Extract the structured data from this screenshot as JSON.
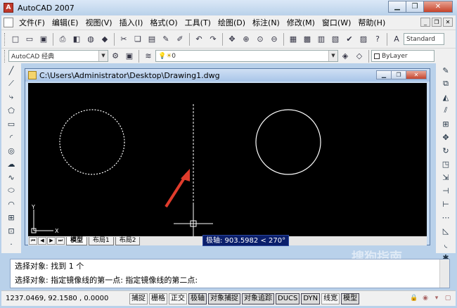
{
  "window": {
    "title": "AutoCAD 2007"
  },
  "menu": [
    "文件(F)",
    "编辑(E)",
    "视图(V)",
    "插入(I)",
    "格式(O)",
    "工具(T)",
    "绘图(D)",
    "标注(N)",
    "修改(M)",
    "窗口(W)",
    "帮助(H)"
  ],
  "toolbar": {
    "text_style": "Standard",
    "workspace": "AutoCAD 经典",
    "layer": "0",
    "color": "ByLayer"
  },
  "drawing_window": {
    "title": "C:\\Users\\Administrator\\Desktop\\Drawing1.dwg"
  },
  "tabs": [
    "模型",
    "布局1",
    "布局2"
  ],
  "ucs": {
    "x_label": "X",
    "y_label": "Y"
  },
  "tooltip": "极轴: 903.5982 < 270°",
  "command": {
    "line1": "选择对象: 找到 1 个",
    "line2": "选择对象:  指定镜像线的第一点: 指定镜像线的第二点:"
  },
  "status": {
    "coords": "1237.0469, 92.1580  , 0.0000",
    "buttons": [
      "捕捉",
      "栅格",
      "正交",
      "极轴",
      "对象捕捉",
      "对象追踪",
      "DUCS",
      "DYN",
      "线宽",
      "模型"
    ]
  },
  "watermark": "搜狗指南",
  "colors": {
    "canvas": "#000000",
    "tooltip_bg": "#0a1e6b",
    "arrow": "#e03c2c"
  }
}
